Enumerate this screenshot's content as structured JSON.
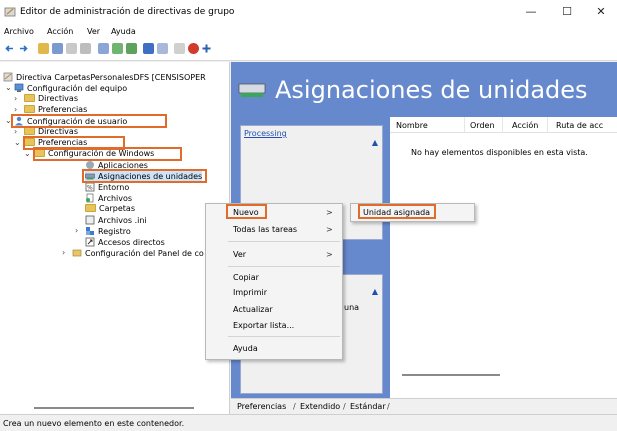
{
  "window": {
    "title": "Editor de administración de directivas de grupo",
    "minimize": "—",
    "maximize": "☐",
    "close": "✕"
  },
  "menubar": [
    "Archivo",
    "Acción",
    "Ver",
    "Ayuda"
  ],
  "tree": {
    "root": "Directiva CarpetasPersonalesDFS [CENSISOPER",
    "computer_config": "Configuración del equipo",
    "computer_policies": "Directivas",
    "computer_prefs": "Preferencias",
    "user_config": "Configuración de usuario",
    "user_policies": "Directivas",
    "user_prefs": "Preferencias",
    "windows_settings": "Configuración de Windows",
    "applications": "Aplicaciones",
    "drive_maps": "Asignaciones de unidades",
    "environment": "Entorno",
    "files": "Archivos",
    "folders": "Carpetas",
    "ini_files": "Archivos .ini",
    "registry": "Registro",
    "shortcuts": "Accesos directos",
    "control_panel": "Configuración del Panel de co"
  },
  "content": {
    "header": "Asignaciones de unidades",
    "processing": "Processing",
    "box2_text": "una",
    "columns": [
      "Nombre",
      "Orden",
      "Acción",
      "Ruta de acc"
    ],
    "empty_message": "No hay elementos disponibles en esta vista."
  },
  "tabs": [
    "Preferencias",
    "Extendido",
    "Estándar"
  ],
  "context_menu": {
    "items": [
      "Nuevo",
      "Todas las tareas",
      "Ver",
      "Copiar",
      "Imprimir",
      "Actualizar",
      "Exportar lista...",
      "Ayuda"
    ],
    "submenu_arrow": ">"
  },
  "submenu": {
    "items": [
      "Unidad asignada"
    ]
  },
  "status": "Crea un nuevo elemento en este contenedor.",
  "colors": {
    "highlight": "#e06b2a",
    "header_bg": "#6688cc",
    "folder": "#e7c35a"
  }
}
